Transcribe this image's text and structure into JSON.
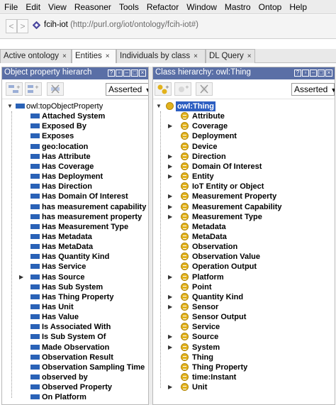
{
  "menu": [
    "File",
    "Edit",
    "View",
    "Reasoner",
    "Tools",
    "Refactor",
    "Window",
    "Mastro",
    "Ontop",
    "Help"
  ],
  "nav": {
    "back": "<",
    "forward": ">"
  },
  "address": {
    "name": "fcih-iot",
    "iri": "(http://purl.org/iot/ontology/fcih-iot#)"
  },
  "tabs": [
    {
      "label": "Active ontology",
      "close": "×"
    },
    {
      "label": "Entities",
      "close": "×"
    },
    {
      "label": "Individuals by class",
      "close": "×"
    },
    {
      "label": "DL Query",
      "close": "×"
    }
  ],
  "left_panel": {
    "title": "Object property hierarch",
    "mode": "Asserted",
    "root": "owl:topObjectProperty",
    "items": [
      "Attached System",
      "Exposed By",
      "Exposes",
      "geo:location",
      "Has Attribute",
      "Has Coverage",
      "Has Deployment",
      "Has Direction",
      "Has Domain Of Interest",
      "has measurement  capability",
      "has measurement property",
      "Has Measurement Type",
      "Has Metadata",
      "Has MetaData",
      "Has Quantity Kind",
      "Has Service",
      "Has Source",
      "Has Sub System",
      "Has Thing Property",
      "Has Unit",
      "Has Value",
      "Is Associated With",
      "Is Sub System Of",
      "Made Observation",
      "Observation Result",
      "Observation Sampling Time",
      "observed by",
      "Observed Property",
      "On Platform"
    ],
    "expandable": [
      16
    ]
  },
  "right_panel": {
    "title": "Class hierarchy: owl:Thing",
    "mode": "Asserted",
    "root": "owl:Thing",
    "items": [
      "Attribute",
      "Coverage",
      "Deployment",
      "Device",
      "Direction",
      "Domain Of Interest",
      "Entity",
      "IoT Entity or Object",
      "Measurement  Property",
      "Measurement Capability",
      "Measurement Type",
      "Metadata",
      "MetaData",
      "Observation",
      "Observation Value",
      "Operation Output",
      "Platform",
      "Point",
      "Quantity Kind",
      "Sensor",
      "Sensor Output",
      "Service",
      "Source",
      "System",
      "Thing",
      "Thing Property",
      "time:Instant",
      "Unit"
    ],
    "expandable": [
      1,
      4,
      5,
      6,
      8,
      9,
      10,
      16,
      18,
      19,
      22,
      23,
      27
    ]
  },
  "colors": {
    "header": "#5a6fa6",
    "property_icon": "#2a62b7",
    "class_icon": "#e2b21c",
    "selection": "#2d5fc2"
  },
  "icons": {
    "property": "object-property-icon",
    "class": "class-icon",
    "ontology": "ontology-icon"
  }
}
